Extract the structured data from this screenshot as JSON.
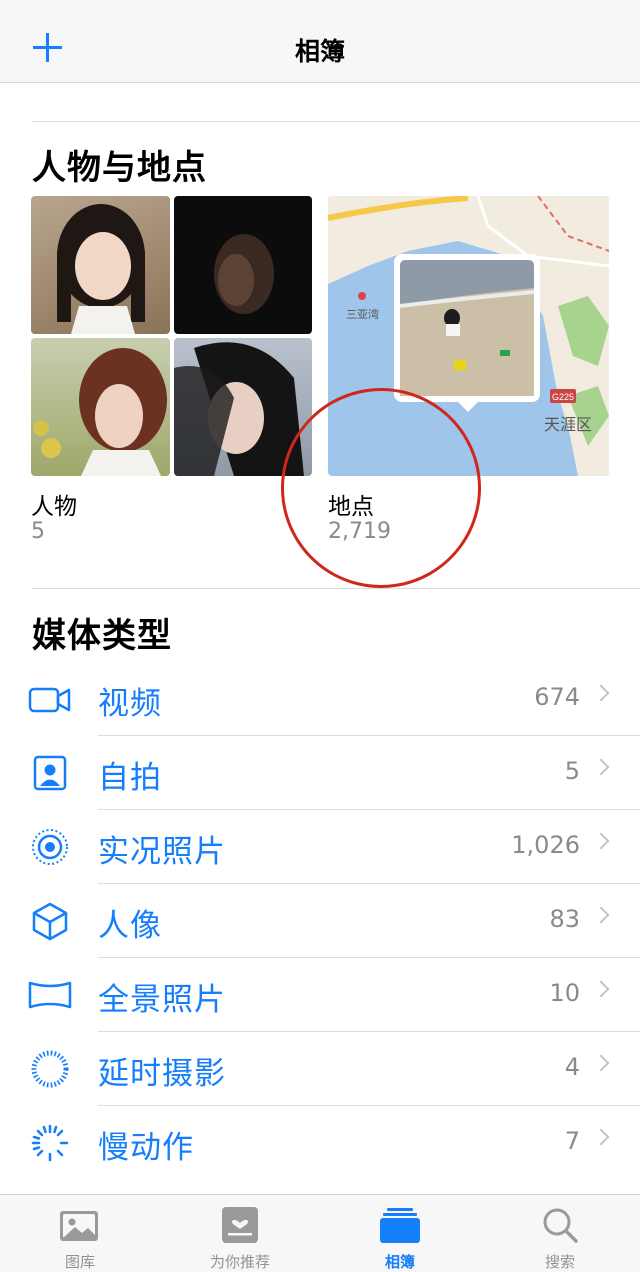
{
  "nav": {
    "title": "相簿"
  },
  "people_places": {
    "title": "人物与地点",
    "people": {
      "label": "人物",
      "count": "5"
    },
    "places": {
      "label": "地点",
      "count": "2,719"
    },
    "map_labels": {
      "sanya_bay": "三亚湾",
      "tianya": "天涯区",
      "road": "G225"
    }
  },
  "media": {
    "title": "媒体类型",
    "items": [
      {
        "icon": "video-icon",
        "label": "视频",
        "count": "674"
      },
      {
        "icon": "selfie-icon",
        "label": "自拍",
        "count": "5"
      },
      {
        "icon": "live-photo-icon",
        "label": "实况照片",
        "count": "1,026"
      },
      {
        "icon": "portrait-cube-icon",
        "label": "人像",
        "count": "83"
      },
      {
        "icon": "panorama-icon",
        "label": "全景照片",
        "count": "10"
      },
      {
        "icon": "timelapse-icon",
        "label": "延时摄影",
        "count": "4"
      },
      {
        "icon": "slomo-icon",
        "label": "慢动作",
        "count": "7"
      }
    ]
  },
  "tabs": [
    {
      "icon": "library-icon",
      "label": "图库",
      "active": false
    },
    {
      "icon": "for-you-icon",
      "label": "为你推荐",
      "active": false
    },
    {
      "icon": "albums-icon",
      "label": "相簿",
      "active": true
    },
    {
      "icon": "search-icon",
      "label": "搜索",
      "active": false
    }
  ],
  "colors": {
    "accent": "#157efb",
    "secondary_text": "#8a8a8e",
    "annotation": "#d0271d"
  }
}
